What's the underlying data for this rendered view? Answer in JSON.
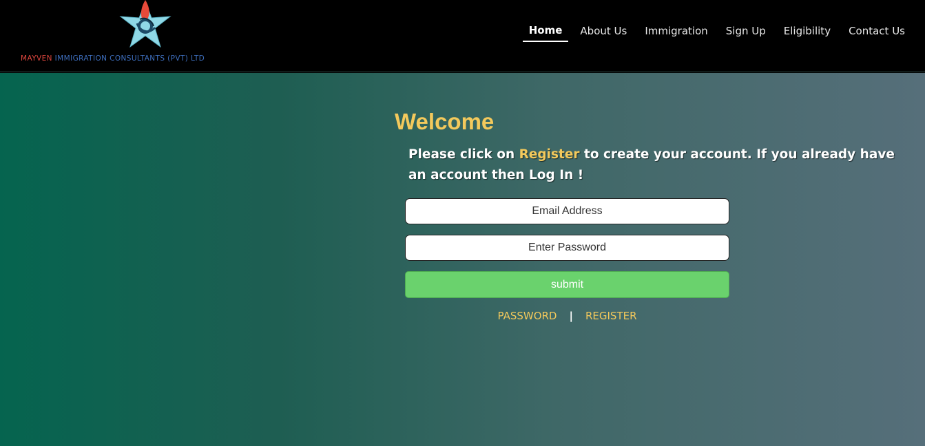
{
  "header": {
    "logo": {
      "icon": "star-logo-icon",
      "brand": "MAYVEN",
      "rest": " IMMIGRATION CONSULTANTS (PVT) LTD"
    },
    "nav": [
      {
        "label": "Home",
        "active": true
      },
      {
        "label": "About Us"
      },
      {
        "label": "Immigration"
      },
      {
        "label": "Sign Up"
      },
      {
        "label": "Eligibility"
      },
      {
        "label": "Contact Us"
      }
    ]
  },
  "main": {
    "title": "Welcome",
    "intro_before": "Please click on ",
    "intro_accent": "Register",
    "intro_after": " to create your account. If you already have an account then Log In !",
    "email_placeholder": "Email Address",
    "password_placeholder": "Enter Password",
    "submit_label": "submit",
    "password_link": "PASSWORD",
    "separator": "|",
    "register_link": "REGISTER"
  },
  "colors": {
    "accent": "#f3c95c",
    "submit": "#6ad26d",
    "header_bg": "#000000"
  }
}
